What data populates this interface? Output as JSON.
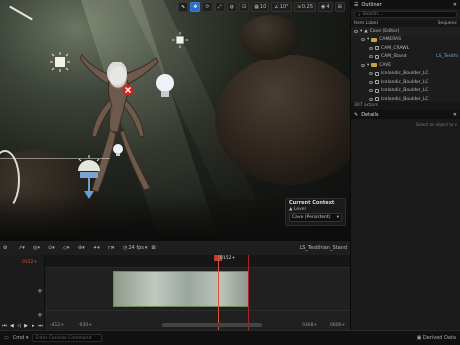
{
  "viewport": {
    "toolbar_right": {
      "camera_speed": "10",
      "grid_size": "10",
      "rotation_snap": "10°",
      "scale_snap": "0.25",
      "layout_count": "4"
    },
    "context_panel": {
      "title": "Current Context",
      "level_label": "Level",
      "level_value": "Cave (Persistent)"
    }
  },
  "outliner": {
    "tab_label": "Outliner",
    "search_placeholder": "Search...",
    "col_item_label": "Item Label",
    "col_type": "Sequenc",
    "rows": [
      {
        "label": "Cave (Editor)",
        "type": ""
      },
      {
        "label": "CAMERAS",
        "type": ""
      },
      {
        "label": "CAM_CRAWL",
        "type": ""
      },
      {
        "label": "CAM_Stand",
        "type": "LS_Tesithi"
      },
      {
        "label": "CAVE",
        "type": ""
      },
      {
        "label": "Icelandic_Boulder_LC",
        "type": ""
      },
      {
        "label": "Icelandic_Boulder_LC",
        "type": ""
      },
      {
        "label": "Icelandic_Boulder_LC",
        "type": ""
      },
      {
        "label": "Icelandic_Boulder_LC",
        "type": ""
      }
    ],
    "actor_count": "307 actors"
  },
  "details": {
    "tab_label": "Details",
    "hint": "Select an object to v"
  },
  "sequencer": {
    "fps": "24 fps",
    "sequence_name": "LS_Tesithian_Stand",
    "current_frame": "0152+",
    "left_frame": "0152+",
    "range_start": "-412+",
    "range_start2": "-030+",
    "range_end": "0308+",
    "range_end2": "0600+"
  },
  "bottombar": {
    "cmd_label": "Cmd",
    "cmd_placeholder": "Enter Console Command",
    "derived_data": "Derived Data"
  }
}
